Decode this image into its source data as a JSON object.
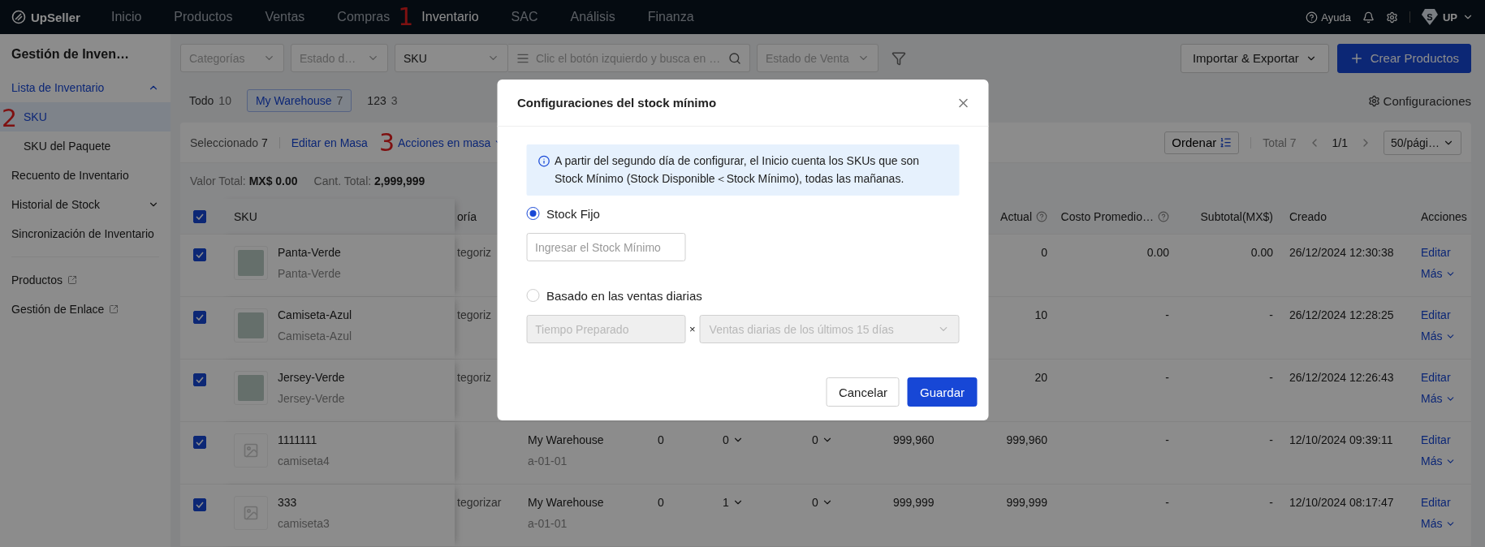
{
  "top_bar": {
    "logo": "UpSeller",
    "nav": [
      {
        "label": "Inicio",
        "selected": false
      },
      {
        "label": "Productos",
        "selected": false
      },
      {
        "label": "Ventas",
        "selected": false
      },
      {
        "label": "Compras",
        "selected": false
      },
      {
        "label": "Inventario",
        "selected": true,
        "marker": "1"
      },
      {
        "label": "SAC",
        "selected": false
      },
      {
        "label": "Análisis",
        "selected": false
      },
      {
        "label": "Finanza",
        "selected": false
      }
    ],
    "help": "Ayuda",
    "avatar_letter": "S",
    "user": "UP"
  },
  "sidebar": {
    "title": "Gestión de Inven…",
    "items": [
      {
        "kind": "group",
        "label": "Lista de Inventario",
        "expanded": true,
        "children": [
          {
            "label": "SKU",
            "selected": true,
            "marker": "2"
          },
          {
            "label": "SKU del Paquete",
            "selected": false
          }
        ]
      },
      {
        "kind": "link",
        "label": "Recuento de Inventario",
        "selected": false
      },
      {
        "kind": "group",
        "label": "Historial de Stock",
        "expanded": false
      },
      {
        "kind": "link",
        "label": "Sincronización de Inventario",
        "selected": false
      },
      {
        "kind": "divider"
      },
      {
        "kind": "external",
        "label": "Productos",
        "selected": false
      },
      {
        "kind": "external",
        "label": "Gestión de Enlace",
        "selected": false
      }
    ]
  },
  "filters": [
    {
      "kind": "select",
      "placeholder": "Categorías"
    },
    {
      "kind": "select",
      "placeholder": "Estado d…"
    },
    {
      "kind": "select",
      "value": "SKU"
    },
    {
      "kind": "search",
      "placeholder": "Clic el botón izquierdo y busca en …"
    },
    {
      "kind": "select",
      "placeholder": "Estado de Venta"
    },
    {
      "kind": "filter"
    }
  ],
  "actions": [
    {
      "kind": "secondary",
      "label": "Importar & Exportar"
    },
    {
      "kind": "primary",
      "label": "Crear Productos"
    }
  ],
  "warehouse_tabs": [
    {
      "label": "Todo",
      "count": "10",
      "selected": false
    },
    {
      "label": "My Warehouse",
      "count": "7",
      "selected": true
    },
    {
      "label": "123",
      "count": "3",
      "selected": false
    }
  ],
  "settings_link": "Configuraciones",
  "toolbar": {
    "selected_label": "Seleccionado",
    "selected_count": "7",
    "bulk_actions": [
      {
        "label": "Editar en Masa",
        "dropdown": false
      },
      {
        "label": "Acciones en masa",
        "marker": "3",
        "dropdown": true
      }
    ],
    "sort": "Ordenar",
    "total": "Total 7",
    "page": "1/1",
    "page_size": "50/pági…"
  },
  "summary": [
    "Valor Total: **MX$ 0.00**",
    "Cant. Total: **2,999,999**"
  ],
  "table": {
    "header_checked": true,
    "columns": [
      {
        "label": "SKU",
        "help": false
      },
      {
        "label": "oría",
        "help": false
      },
      {
        "label": "Actual",
        "help": true
      },
      {
        "label": "Costo Promedio…",
        "help": true
      },
      {
        "label": "Subtotal(MX$)",
        "help": false
      },
      {
        "label": "Creado",
        "help": false
      },
      {
        "label": "Acciones",
        "help": false
      }
    ],
    "rows": [
      {
        "checked": true,
        "kind": "photo",
        "sku": "Panta-Verde",
        "name": "Panta-Verde",
        "column_3": "tegoriz",
        "actual": "0",
        "avg_cost": "0.00",
        "subtotal": "0.00",
        "created": "26/12/2024 12:30:38",
        "actions": [
          "Editar",
          "Más"
        ]
      },
      {
        "checked": true,
        "kind": "photo",
        "sku": "Camiseta-Azul",
        "name": "Camiseta-Azul",
        "column_3": "tegoriz",
        "actual": "10",
        "avg_cost": "-",
        "subtotal": "-",
        "created": "26/12/2024 12:28:25",
        "actions": [
          "Editar",
          "Más"
        ]
      },
      {
        "checked": true,
        "kind": "photo",
        "sku": "Jersey-Verde",
        "name": "Jersey-Verde",
        "column_3": "tegoriz",
        "actual": "20",
        "avg_cost": "-",
        "subtotal": "-",
        "created": "26/12/2024 12:26:43",
        "actions": [
          "Editar",
          "Más"
        ]
      },
      {
        "checked": true,
        "kind": "no_image",
        "sku": "1111111",
        "name": "camiseta4",
        "warehouse": "My Warehouse",
        "location": "a-01-01",
        "column_5": "0",
        "column_6": "0",
        "column_7": "0",
        "column_8": "999,960",
        "actual": "999,960",
        "avg_cost": "-",
        "subtotal": "-",
        "created": "12/10/2024 09:39:11",
        "actions": [
          "Editar",
          "Más"
        ]
      },
      {
        "checked": true,
        "kind": "no_image",
        "sku": "333",
        "name": "camiseta3",
        "column_3": "tegorizar",
        "warehouse": "My Warehouse",
        "location": "a-01-01",
        "column_5": "0",
        "column_6": "1",
        "column_7": "0",
        "column_8": "999,999",
        "actual": "999,999",
        "avg_cost": "-",
        "subtotal": "-",
        "created": "12/10/2024 08:17:47",
        "actions": [
          "Editar",
          "Más"
        ]
      }
    ]
  },
  "modal": {
    "title": "Configuraciones del stock mínimo",
    "notice": "A partir del segundo día de configurar, el Inicio cuenta los SKUs que son Stock Mínimo (Stock Disponible＜Stock Mínimo), todas las mañanas.",
    "options": [
      {
        "label": "Stock Fijo",
        "selected": true,
        "fields": [
          {
            "kind": "input",
            "placeholder": "Ingresar el Stock Mínimo",
            "disabled": false
          }
        ]
      },
      {
        "label": "Basado en las ventas diarias",
        "selected": false,
        "fields": [
          {
            "kind": "input",
            "placeholder": "Tiempo Preparado",
            "disabled": true
          },
          {
            "kind": "operator",
            "text": "×"
          },
          {
            "kind": "select",
            "placeholder": "Ventas diarias de los últimos 15 días",
            "disabled": true
          }
        ]
      }
    ],
    "buttons": [
      {
        "kind": "secondary",
        "label": "Cancelar"
      },
      {
        "kind": "primary",
        "label": "Guardar"
      }
    ]
  }
}
